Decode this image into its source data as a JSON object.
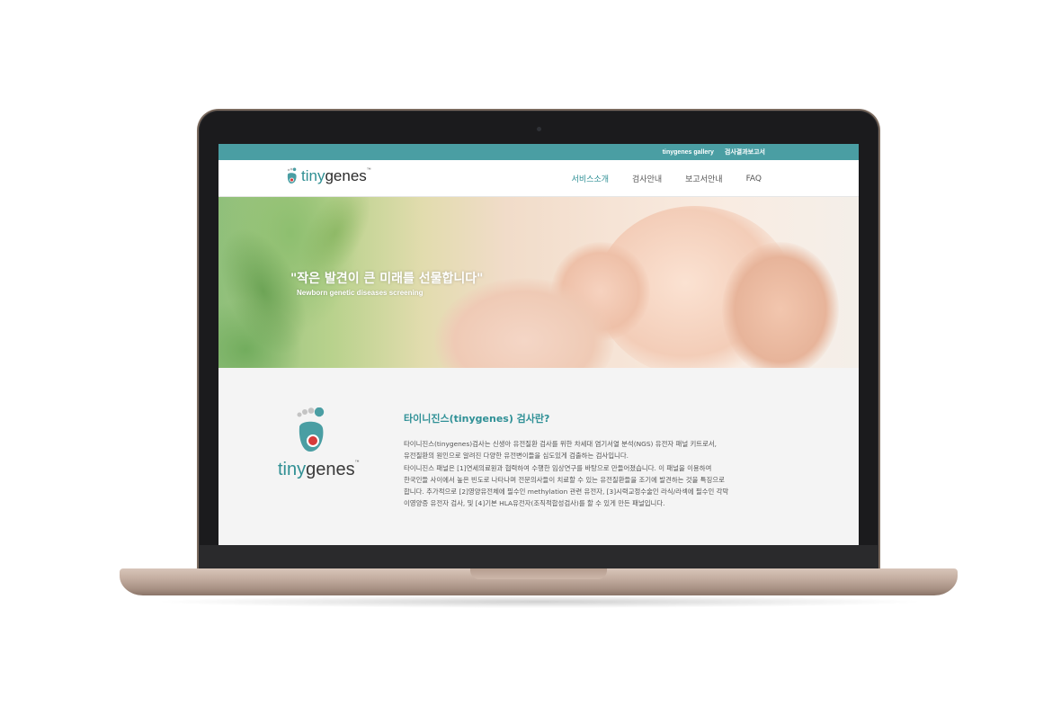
{
  "topbar": {
    "links": [
      "tinygenes gallery",
      "검사결과보고서"
    ]
  },
  "header": {
    "logo": {
      "tiny": "tiny",
      "genes": "genes",
      "tm": "™"
    },
    "nav": [
      {
        "label": "서비스소개",
        "active": true
      },
      {
        "label": "검사안내",
        "active": false
      },
      {
        "label": "보고서안내",
        "active": false
      },
      {
        "label": "FAQ",
        "active": false
      }
    ]
  },
  "hero": {
    "title": "\"작은 발견이 큰 미래를 선물합니다\"",
    "subtitle": "Newborn genetic diseases screening"
  },
  "intro": {
    "logo": {
      "tiny": "tiny",
      "genes": "genes",
      "tm": "™"
    },
    "title": "타이니진스(tinygenes) 검사란?",
    "body": [
      "타이니진스(tinygenes)검사는 신생아 유전질환 검사를 위한 차세대 염기서열 분석(NGS) 유전자 패널 키트로서,",
      "유전질환의 원인으로 알려진 다양한 유전변이들을 심도있게 검출하는 검사입니다.",
      "타이니진스 패널은 [1]연세의료원과 협력하여 수행한 임상연구를 바탕으로 만들어졌습니다. 이 패널을 이용하여",
      "한국인들 사이에서 높은 빈도로 나타나며 전문의사들이 치료할 수 있는 유전질환들을 조기에 발견하는 것을 특징으로",
      "합니다. 추가적으로 [2]영양유전체에 필수인 methylation 관련 유전자, [3]시력교정수술인 라식/라섹에 필수인 각막",
      "이영양증 유전자 검사, 및 [4]기본 HLA유전자(조직적합성검사)를 할 수 있게 만든 패널입니다."
    ]
  },
  "colors": {
    "brand_teal": "#4a9ea3",
    "accent_teal": "#2f9096",
    "logo_red": "#d63b3b",
    "laptop_gold": "#c5afa2"
  }
}
